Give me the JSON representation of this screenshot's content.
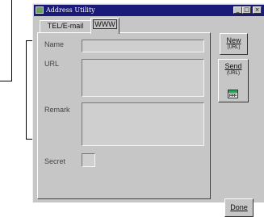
{
  "window": {
    "title": "Address Utility",
    "controls": {
      "minimize": "_",
      "maximize": "□",
      "close": "×"
    }
  },
  "tabs": [
    {
      "label": "TEL/E-mail",
      "selected": false
    },
    {
      "label": "WWW",
      "selected": true
    }
  ],
  "form": {
    "name_label": "Name",
    "url_label": "URL",
    "remark_label": "Remark",
    "secret_label": "Secret",
    "name_value": "",
    "url_value": "",
    "remark_value": "",
    "secret_checked": false
  },
  "buttons": {
    "new_label": "New",
    "new_sub": "(URL)",
    "send_label": "Send",
    "send_sub": "(URL)",
    "send_icon": "table-icon",
    "done_label": "Done"
  },
  "colors": {
    "titlebar": "#1a1a7a",
    "window_face": "#c6c6c6",
    "icon_green": "#2aa05a"
  }
}
